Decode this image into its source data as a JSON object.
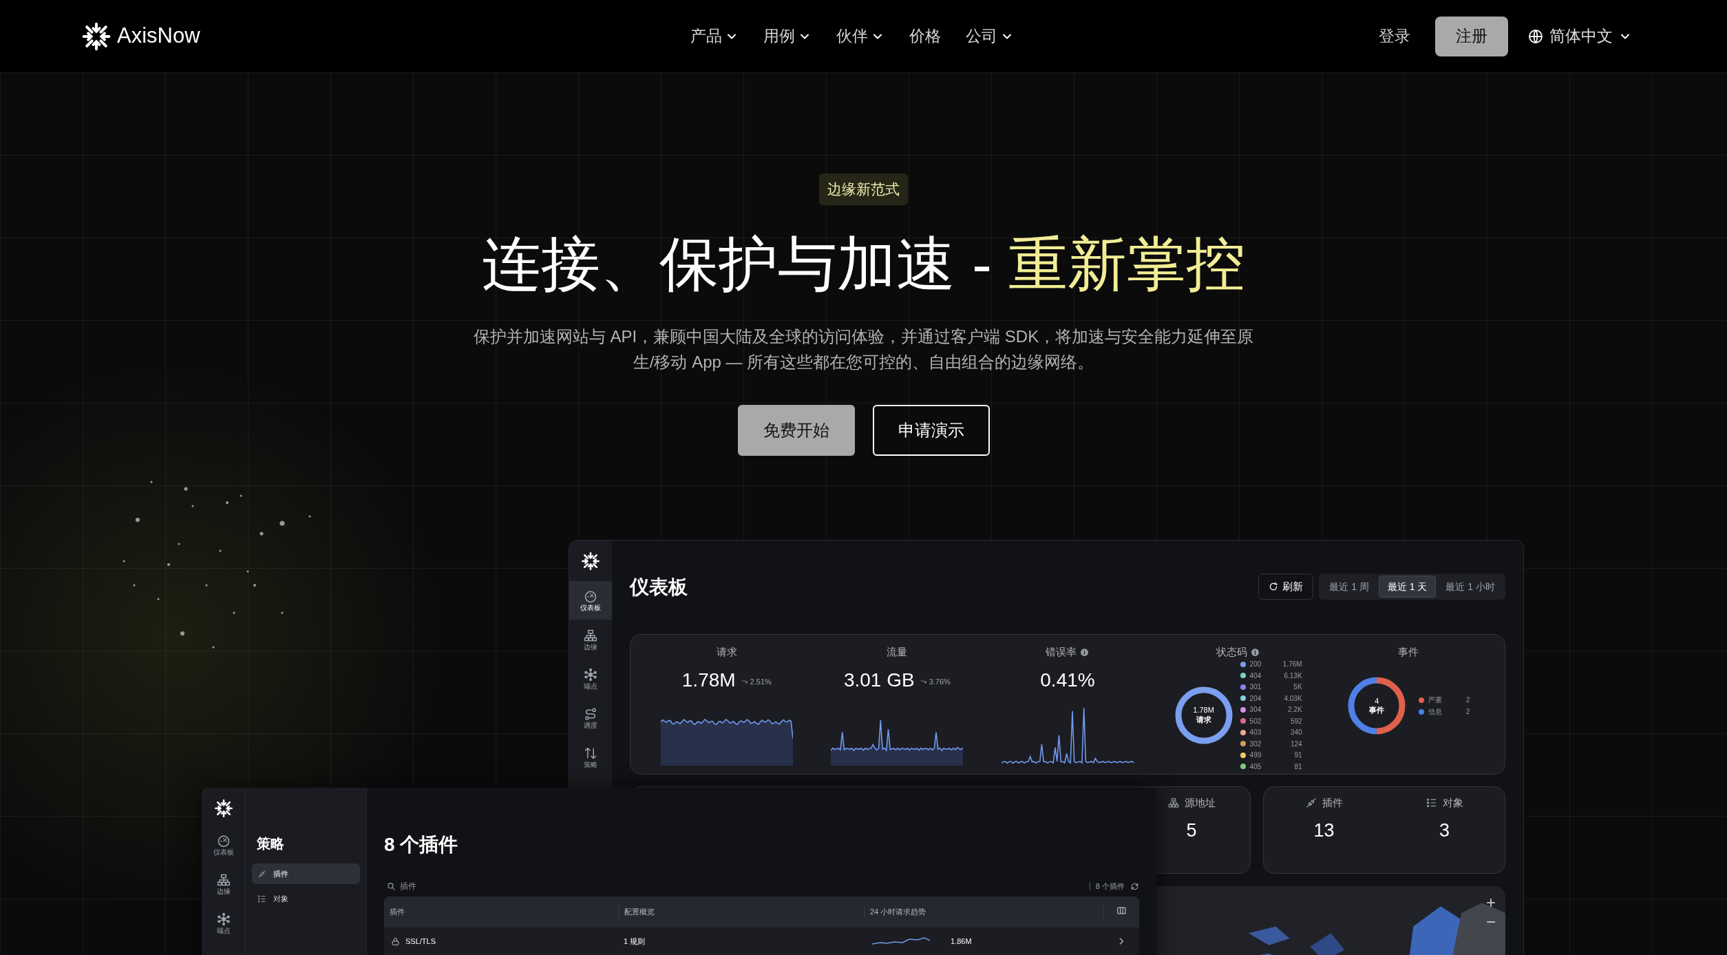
{
  "nav": {
    "brand": "AxisNow",
    "links": [
      {
        "label": "产品",
        "dropdown": true
      },
      {
        "label": "用例",
        "dropdown": true
      },
      {
        "label": "伙伴",
        "dropdown": true
      },
      {
        "label": "价格",
        "dropdown": false
      },
      {
        "label": "公司",
        "dropdown": true
      }
    ],
    "login": "登录",
    "signup": "注册",
    "language": "简体中文"
  },
  "hero": {
    "badge": "边缘新范式",
    "headline": "连接、保护与加速 - ",
    "headline_highlight": "重新掌控",
    "description": "保护并加速网站与 API，兼顾中国大陆及全球的访问体验，并通过客户端 SDK，将加速与安全能力延伸至原生/移动 App — 所有这些都在您可控的、自由组合的边缘网络。",
    "buttons": [
      {
        "label": "免费开始",
        "kind": "primary"
      },
      {
        "label": "申请演示",
        "kind": "outline"
      }
    ]
  },
  "dashboard": {
    "sidebar": [
      {
        "label": "仪表板",
        "selected": true
      },
      {
        "label": "边缘",
        "selected": false
      },
      {
        "label": "端点",
        "selected": false
      },
      {
        "label": "调度",
        "selected": false
      },
      {
        "label": "策略",
        "selected": false
      }
    ],
    "title": "仪表板",
    "refresh": "刷新",
    "ranges": [
      {
        "label": "最近 1 周",
        "selected": false
      },
      {
        "label": "最近 1 天",
        "selected": true
      },
      {
        "label": "最近 1 小时",
        "selected": false
      }
    ],
    "metrics": [
      {
        "kind": "area",
        "label": "请求",
        "value": "1.78M",
        "change": "2.51%",
        "info": false
      },
      {
        "kind": "area",
        "label": "流量",
        "value": "3.01 GB",
        "change": "3.76%",
        "info": false
      },
      {
        "kind": "line",
        "label": "错误率",
        "value": "0.41%",
        "info": true
      }
    ],
    "status_codes": {
      "label": "状态码",
      "info": true,
      "total": "1.78M",
      "total_label": "请求",
      "codes": [
        {
          "code": "200",
          "count": "1.76M",
          "color": "#7a9ff0"
        },
        {
          "code": "404",
          "count": "6.13K",
          "color": "#7fd1c0"
        },
        {
          "code": "301",
          "count": "5K",
          "color": "#8c7ff0"
        },
        {
          "code": "204",
          "count": "4.03K",
          "color": "#85cfe0"
        },
        {
          "code": "304",
          "count": "2.2K",
          "color": "#d88fe6"
        },
        {
          "code": "502",
          "count": "592",
          "color": "#e06a8f"
        },
        {
          "code": "403",
          "count": "340",
          "color": "#eba898"
        },
        {
          "code": "302",
          "count": "124",
          "color": "#d49a5a"
        },
        {
          "code": "499",
          "count": "91",
          "color": "#eccd6a"
        },
        {
          "code": "405",
          "count": "81",
          "color": "#7fcf7a"
        }
      ]
    },
    "events": {
      "label": "事件",
      "total": "4",
      "total_label": "事件",
      "items": [
        {
          "name": "严重",
          "count": "2",
          "color": "#e0604c"
        },
        {
          "name": "信息",
          "count": "2",
          "color": "#4f80e8"
        }
      ]
    },
    "counts": [
      {
        "label": "源地址",
        "value": "5"
      },
      {
        "label": "插件",
        "value": "13"
      },
      {
        "label": "对象",
        "value": "3"
      }
    ],
    "map": {
      "kind": "picture",
      "zoom_in": "+",
      "zoom_out": "−"
    }
  },
  "policy_window": {
    "sidebar": [
      {
        "label": "仪表板"
      },
      {
        "label": "边缘"
      },
      {
        "label": "端点"
      }
    ],
    "section": "策略",
    "menu": [
      {
        "label": "插件",
        "selected": true
      },
      {
        "label": "对象",
        "selected": false
      }
    ],
    "title": "8 个插件",
    "search": {
      "placeholder": "插件"
    },
    "count": "8 个插件",
    "columns": [
      "插件",
      "配置概览",
      "24 小时请求趋势"
    ],
    "rows": [
      {
        "name": "SSL/TLS",
        "config": "1 规则",
        "requests": "1.86M"
      }
    ]
  }
}
